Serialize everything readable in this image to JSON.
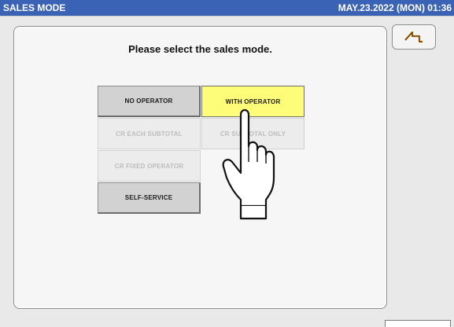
{
  "titlebar": {
    "title": "SALES MODE",
    "datetime": "MAY.23.2022 (MON) 01:36"
  },
  "prompt": "Please select the sales mode.",
  "modes": {
    "no_operator": "NO OPERATOR",
    "with_operator": "WITH OPERATOR",
    "cr_each_subtotal": "CR EACH SUBTOTAL",
    "cr_subtotal_only": "CR SUBTOTAL ONLY",
    "cr_fixed_operator": "CR FIXED OPERATOR",
    "self_service": "SELF-SERVICE"
  },
  "selected_mode": "WITH OPERATOR",
  "icons": {
    "back": "back-arrow-icon",
    "pointer": "pointing-hand-icon"
  },
  "colors": {
    "titlebar": "#3a63b6",
    "selected": "#fffc7a",
    "button": "#d2d2d2",
    "disabled_text": "#bdbdbd"
  }
}
